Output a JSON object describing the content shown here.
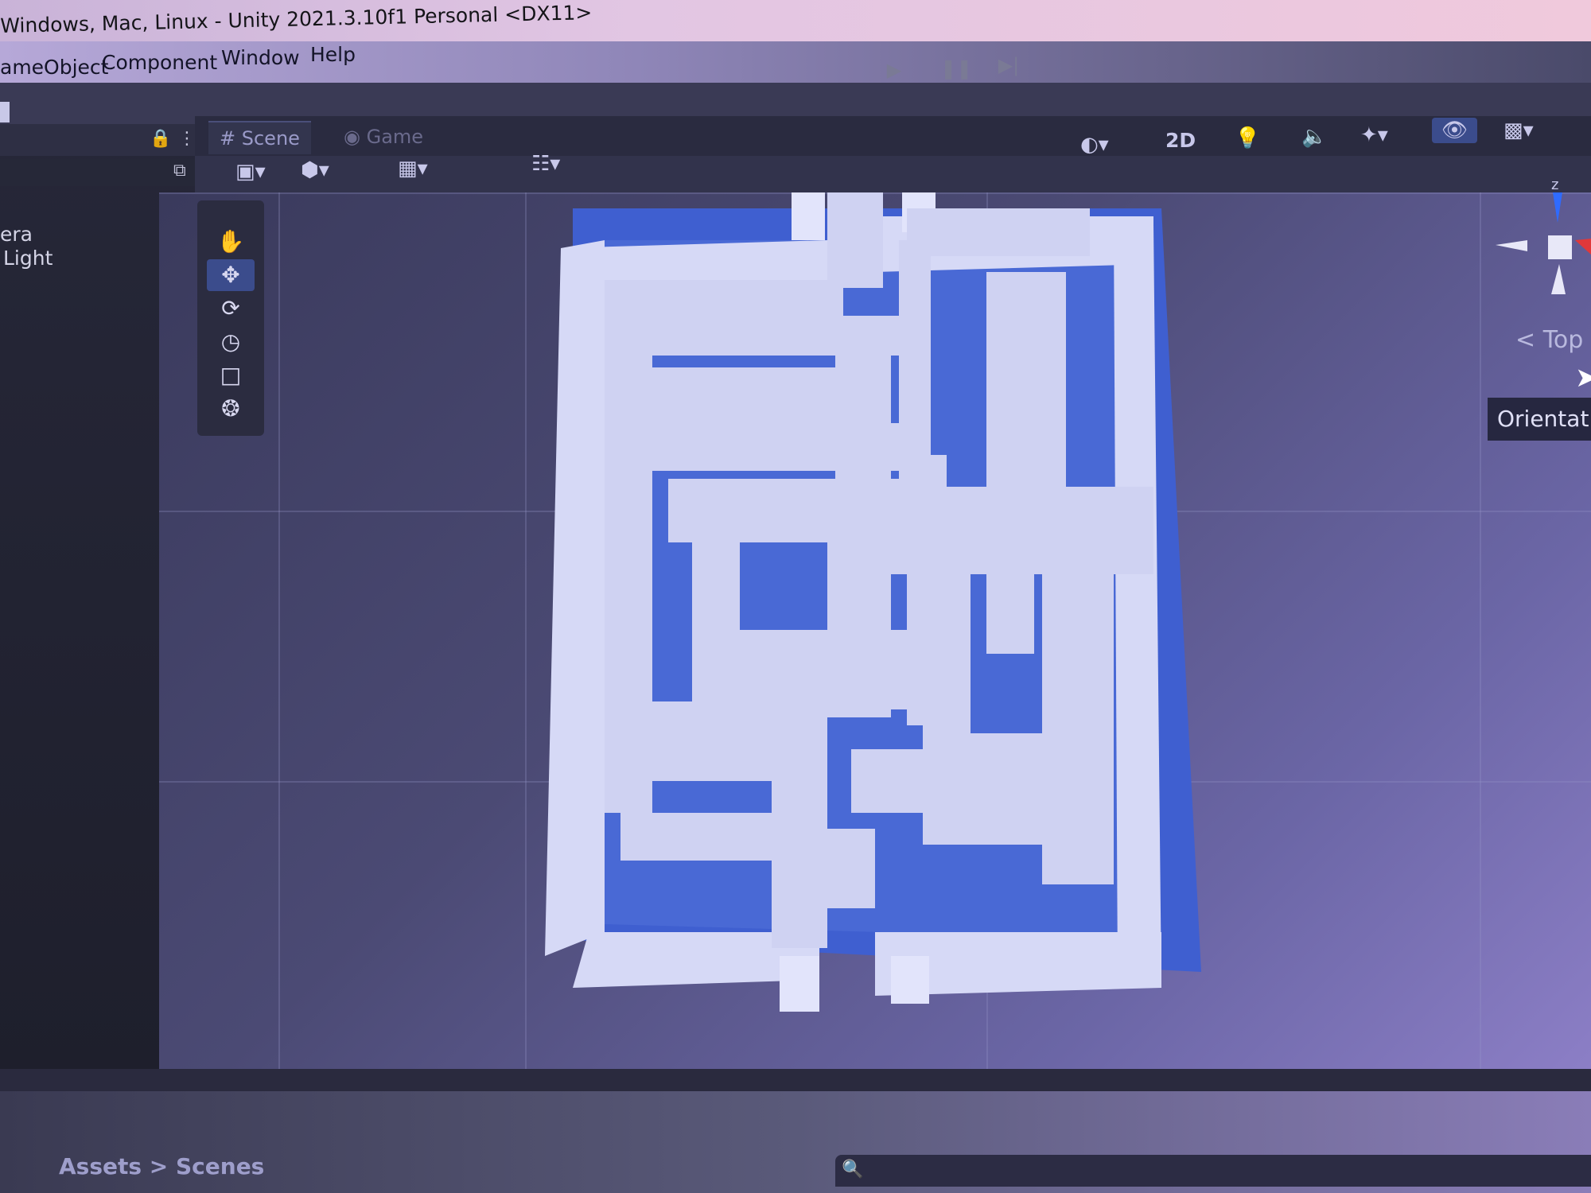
{
  "window": {
    "title": "Windows, Mac, Linux - Unity 2021.3.10f1 Personal <DX11>"
  },
  "menu": {
    "items": [
      {
        "label": "ameObject"
      },
      {
        "label": "Component"
      },
      {
        "label": "Window"
      },
      {
        "label": "Help"
      }
    ]
  },
  "play_controls": {
    "play_icon": "play-icon",
    "pause_icon": "pause-icon",
    "step_icon": "step-icon"
  },
  "hierarchy": {
    "items": [
      {
        "label": "era"
      },
      {
        "label": "Light"
      }
    ]
  },
  "scene_view": {
    "tabs": [
      {
        "label": "Scene",
        "icon": "hash-icon"
      },
      {
        "label": "Game",
        "icon": "gamepad-icon"
      }
    ],
    "toolbar": {
      "mode_2d_label": "2D"
    },
    "gizmo": {
      "axis_z_label": "z",
      "view_label": "Top"
    },
    "tooltip": "Orientation"
  },
  "project": {
    "breadcrumb": "Assets > Scenes"
  },
  "colors": {
    "maze_wall": "#cfd2f2",
    "maze_floor": "#3f5fd0",
    "move_tool_active": "#3b4c8c",
    "gizmo_z": "#2f6bff",
    "gizmo_x": "#e0383a"
  }
}
